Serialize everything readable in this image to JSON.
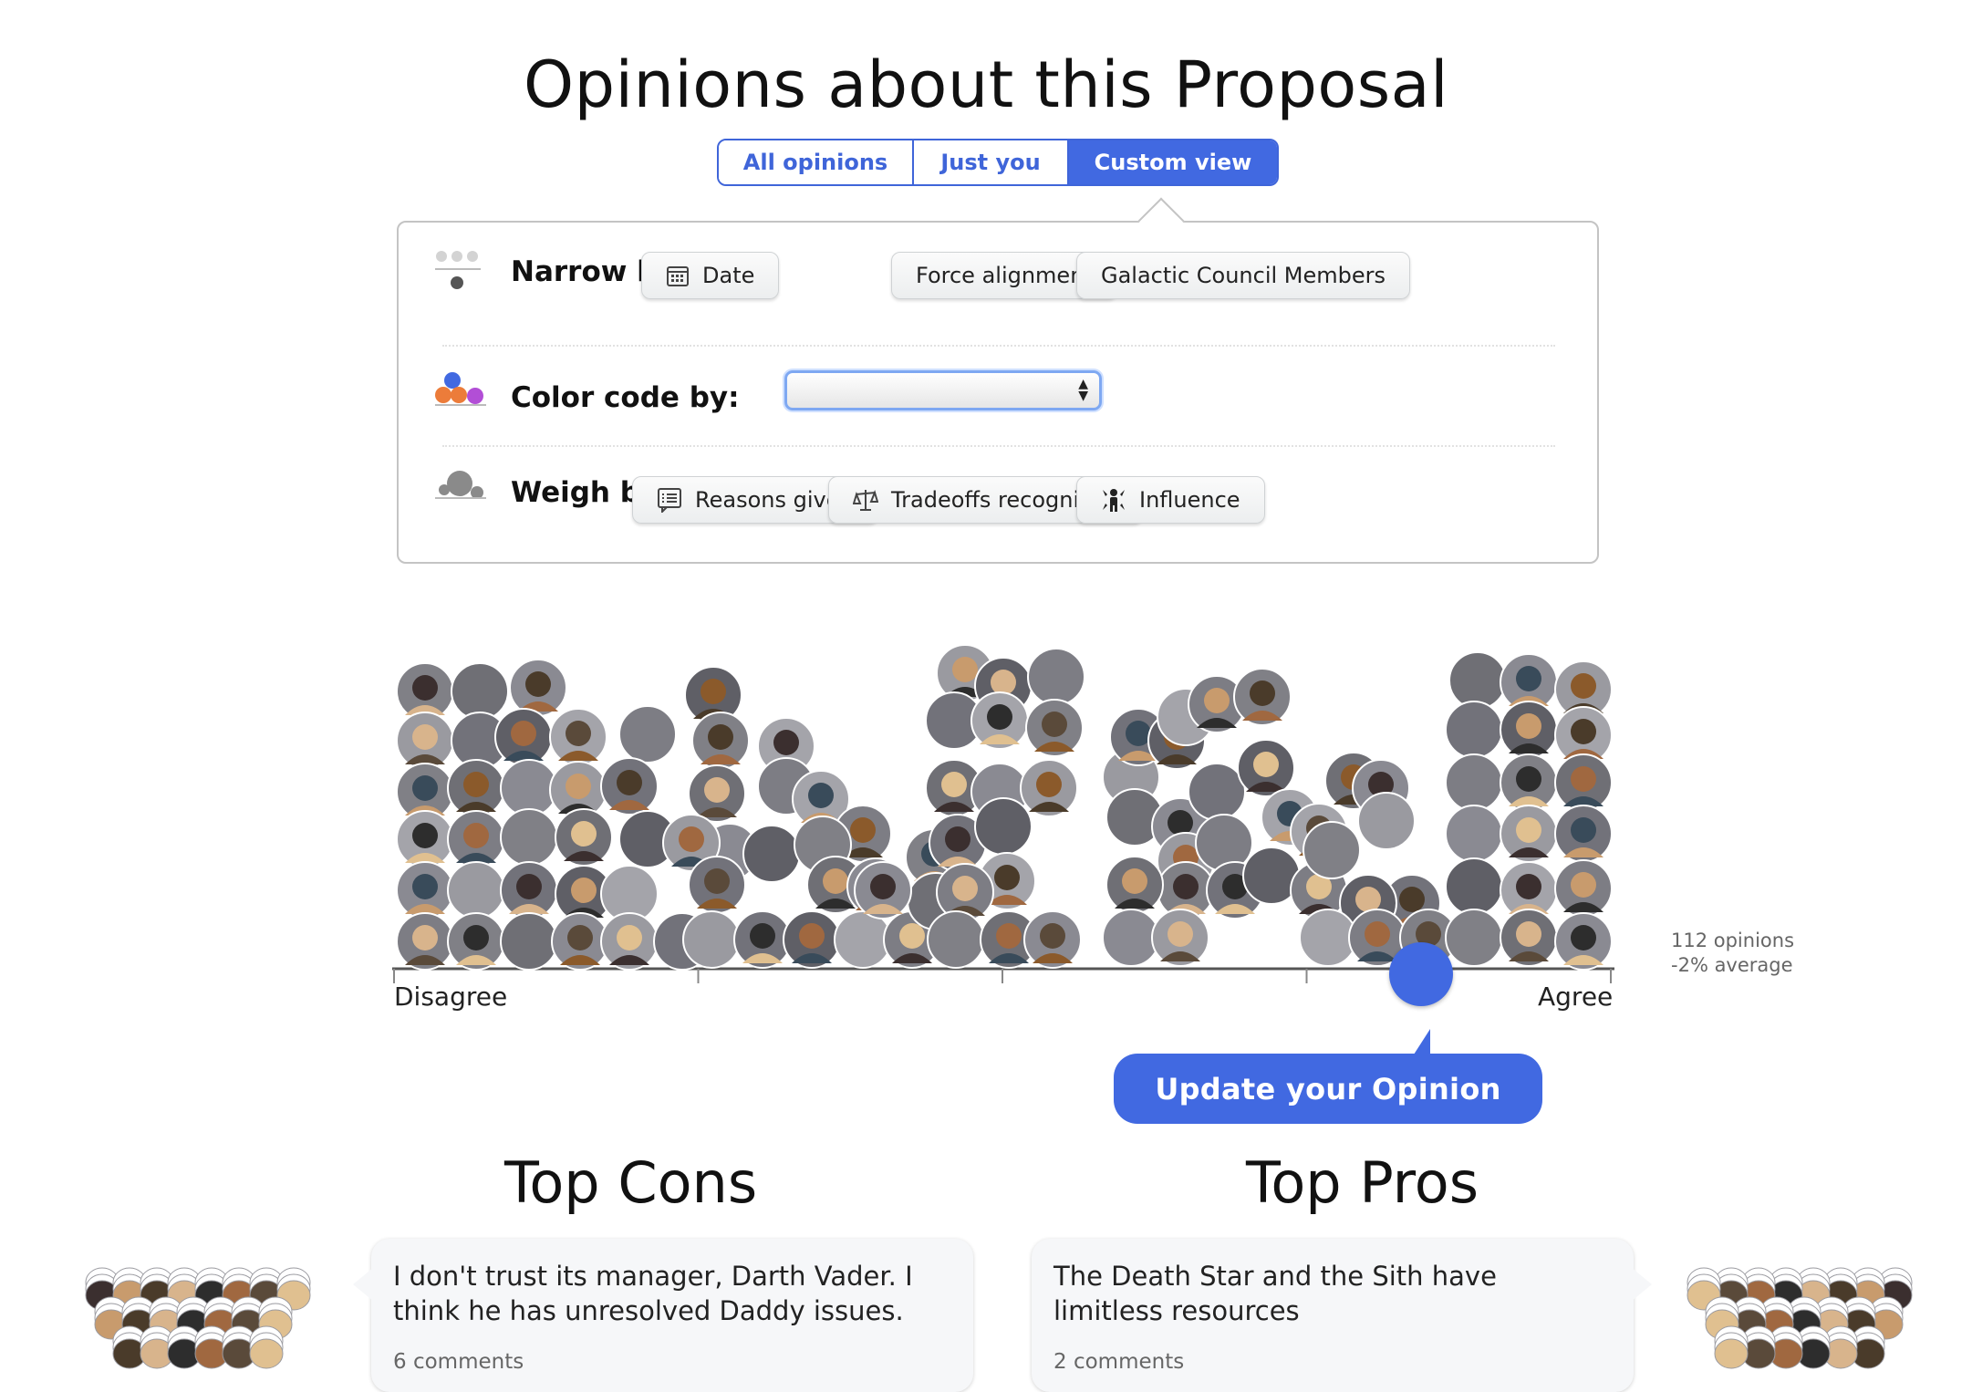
{
  "page": {
    "title": "Opinions about this Proposal"
  },
  "view_tabs": [
    {
      "label": "All opinions",
      "active": false
    },
    {
      "label": "Just you",
      "active": false
    },
    {
      "label": "Custom view",
      "active": true
    }
  ],
  "custom_view": {
    "narrow_by": {
      "label": "Narrow by:",
      "options": [
        {
          "label": "Date",
          "icon": "calendar-icon"
        },
        {
          "label": "Force alignment"
        },
        {
          "label": "Galactic Council Members"
        }
      ]
    },
    "color_code_by": {
      "label": "Color code by:",
      "selected": ""
    },
    "weigh_by": {
      "label": "Weigh by:",
      "options": [
        {
          "label": "Reasons given",
          "icon": "reasons-list-icon"
        },
        {
          "label": "Tradeoffs recognized",
          "icon": "scales-icon"
        },
        {
          "label": "Influence",
          "icon": "influence-icon"
        }
      ]
    }
  },
  "histogram": {
    "left_label": "Disagree",
    "right_label": "Agree",
    "opinion_count_text": "112 opinions",
    "average_text": "-2% average",
    "opinion_count": 112,
    "average_percent": -2,
    "your_opinion_position": 0.64
  },
  "update_button": {
    "label": "Update your Opinion"
  },
  "top_cons": {
    "heading": "Top Cons",
    "text": "I don't trust its manager, Darth Vader. I think he has unresolved Daddy issues.",
    "comments": "6 comments"
  },
  "top_pros": {
    "heading": "Top Pros",
    "text": "The Death Star and the Sith have limitless resources",
    "comments": "2 comments"
  },
  "colors": {
    "accent": "#4169e1",
    "placeholder_avatar": "#808086",
    "axis": "#555555"
  }
}
